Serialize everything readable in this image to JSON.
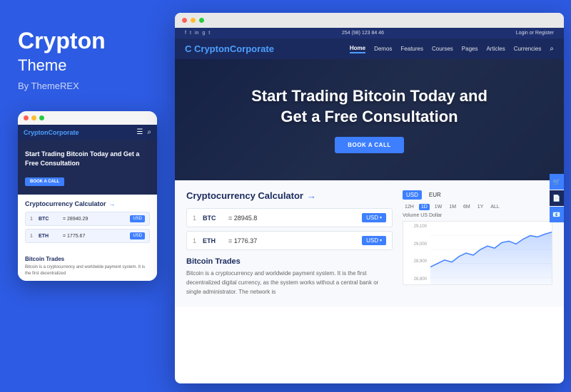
{
  "brand": {
    "title": "Crypton",
    "subtitle": "Theme",
    "by": "By ThemeREX"
  },
  "mobile": {
    "logo": "Crypton",
    "logo_accent": "Corporate",
    "hero_title": "Start Trading Bitcoin Today and Get a Free Consultation",
    "cta_btn": "BOOK A CALL",
    "calc_title": "Cryptocurrency Calculator",
    "calc_rows": [
      {
        "num": "1",
        "crypto": "BTC",
        "separator": "=",
        "value": "28940.29",
        "currency": "USD"
      },
      {
        "num": "1",
        "crypto": "ETH",
        "separator": "=",
        "value": "1775.67",
        "currency": "USD"
      }
    ],
    "info_title": "Bitcoin Trades",
    "info_text": "Bitcoin is a cryptocurrency and worldwide payment system. It is the first decentralized"
  },
  "desktop": {
    "social_icons": [
      "f",
      "t",
      "in",
      "g+",
      "t"
    ],
    "phone": "254 (98) 123 84 46",
    "auth": "Login or Register",
    "logo": "Crypton",
    "logo_accent": "Corporate",
    "nav_links": [
      "Home",
      "Demos",
      "Features",
      "Courses",
      "Pages",
      "Articles",
      "Currencies"
    ],
    "hero_title": "Start Trading Bitcoin Today and\nGet a Free Consultation",
    "hero_btn": "BOOK A CALL",
    "calc_title": "Cryptocurrency Calculator",
    "calc_rows": [
      {
        "num": "1",
        "crypto": "BTC",
        "separator": "=",
        "value": "28945.8",
        "currency": "USD"
      },
      {
        "num": "1",
        "crypto": "ETH",
        "separator": "=",
        "value": "1776.37",
        "currency": "USD"
      }
    ],
    "currency_tabs": [
      "USD",
      "EUR"
    ],
    "time_tabs": [
      "12H",
      "1D",
      "1W",
      "1M",
      "6M",
      "1Y",
      "ALL"
    ],
    "active_time": "1D",
    "chart_label": "Volume US Dollar",
    "chart_y_values": [
      "29,100",
      "29,000",
      "28,900",
      "28,800"
    ],
    "info_title": "Bitcoin Trades",
    "info_text": "Bitcoin is a cryptocurrency and worldwide payment system. It is the first decentralized digital currency, as the system works without a central bank or single administrator. The network is"
  },
  "colors": {
    "blue": "#2d5be3",
    "dark_nav": "#1a2a5e",
    "accent": "#3d7fff"
  }
}
